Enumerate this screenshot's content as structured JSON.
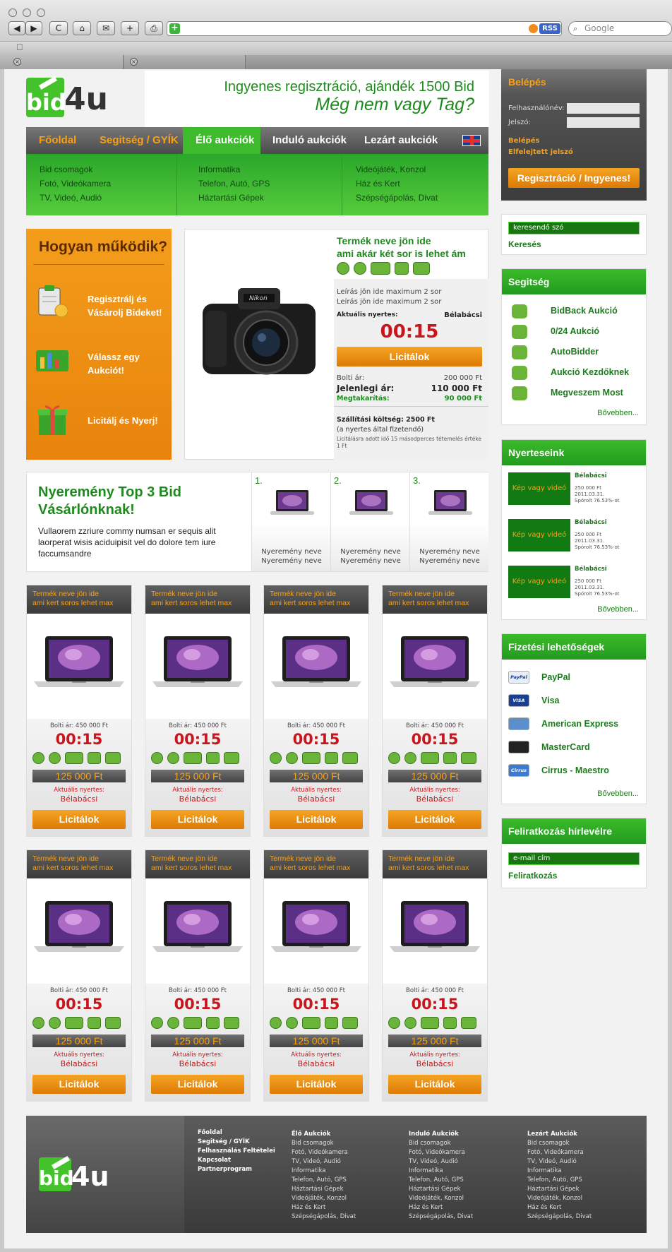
{
  "browser": {
    "nav_buttons": [
      "◀",
      "▶",
      "C",
      "⌂",
      "✉",
      "+",
      "⎙"
    ],
    "rss_label": "RSS",
    "search_placeholder": "Google",
    "bookmarks_icon": "book-icon"
  },
  "header": {
    "logo_bid": "bid",
    "logo_4u": "4u",
    "line1": "Ingyenes regisztráció, ajándék 1500 Bid",
    "line2": "Még nem vagy Tag?"
  },
  "nav": {
    "items": [
      "Főoldal",
      "Segitség / GYÍK",
      "Élő aukciók",
      "Induló aukciók",
      "Lezárt aukciók"
    ],
    "active_index": 2
  },
  "subnav": {
    "col1": [
      "Bid csomagok",
      "Fotó, Videókamera",
      "TV, Videó, Audió"
    ],
    "col2": [
      "Informatika",
      "Telefon, Autó, GPS",
      "Háztartási Gépek"
    ],
    "col3": [
      "Videójáték, Konzol",
      "Ház és Kert",
      "Szépségápolás, Divat"
    ]
  },
  "how": {
    "title": "Hogyan működik?",
    "steps": [
      "Regisztrálj és\nVásárolj Bideket!",
      "Válassz egy\nAukciót!",
      "Licitálj és Nyerj!"
    ]
  },
  "featured": {
    "name": "Termék neve jön ide\nami akár két sor is lehet ám",
    "desc1": "Leírás jön ide maximum 2 sor",
    "desc2": "Leírás jön ide maximum 2 sor",
    "winner_label": "Aktuális nyertes:",
    "winner": "Bélabácsi",
    "timer": "00:15",
    "button": "Licitálok",
    "store_label": "Bolti ár:",
    "store_price": "200 000 Ft",
    "current_label": "Jelenlegi ár:",
    "current_price": "110 000 Ft",
    "saving_label": "Megtakarítás:",
    "saving": "90 000 Ft",
    "shipping": "Szállítási költség: 2500 Ft",
    "shipping_note": "(a nyertes által fizetendő)",
    "bid_note": "Licitálásra adott idő 15 másodperces tétemelés értéke 1 Ft"
  },
  "top3": {
    "title": "Nyeremény Top 3 Bid\nVásárlónknak!",
    "desc": "Vullaorem zzriure commy numsan er sequis alit laorperat wisis aciduipisit vel do dolore tem iure faccumsandre",
    "items": [
      {
        "num": "1.",
        "cap1": "Nyeremény neve",
        "cap2": "Nyeremény neve"
      },
      {
        "num": "2.",
        "cap1": "Nyeremény neve",
        "cap2": "Nyeremény neve"
      },
      {
        "num": "3.",
        "cap1": "Nyeremény neve",
        "cap2": "Nyeremény neve"
      }
    ]
  },
  "product_card": {
    "name": "Termék neve jön ide\nami kert soros lehet max",
    "store_price": "Bolti ár: 450 000 Ft",
    "timer": "00:15",
    "bid": "125 000 Ft",
    "winner_label": "Aktuális nyertes:",
    "winner": "Bélabácsi",
    "button": "Licitálok"
  },
  "product_cards_count": 8,
  "icon_row": [
    "moneybag-icon",
    "clock-icon",
    "truck-icon",
    "wrench-icon",
    "cart-icon"
  ],
  "login": {
    "title": "Belépés",
    "user_label": "Felhasználónév:",
    "pass_label": "Jelszó:",
    "login_link": "Belépés",
    "forgot_link": "Elfelejtett jelszó",
    "register_btn": "Regisztráció / Ingyenes!"
  },
  "search": {
    "placeholder": "keresendő szó",
    "button": "Keresés"
  },
  "help": {
    "title": "Segitség",
    "items": [
      "BidBack Aukció",
      "0/24 Aukció",
      "AutoBidder",
      "Aukció Kezdőknek",
      "Megveszem Most"
    ],
    "more": "Bővebben..."
  },
  "winners": {
    "title": "Nyerteseink",
    "items": [
      {
        "box": "Kép vagy videó",
        "name": "Bélabácsi",
        "d1": "250 000 Ft",
        "d2": "2011.03.31.",
        "d3": "Spórolt 76.53%-ot"
      },
      {
        "box": "Kép vagy videó",
        "name": "Bélabácsi",
        "d1": "250 000 Ft",
        "d2": "2011.03.31.",
        "d3": "Spórolt 76.53%-ot"
      },
      {
        "box": "Kép vagy videó",
        "name": "Bélabácsi",
        "d1": "250 000 Ft",
        "d2": "2011.03.31.",
        "d3": "Spórolt 76.53%-ot"
      }
    ],
    "more": "Bővebben..."
  },
  "payment": {
    "title": "Fizetési lehetőségek",
    "items": [
      "PayPal",
      "Visa",
      "American Express",
      "MasterCard",
      "Cirrus - Maestro"
    ],
    "icon_texts": [
      "PayPal",
      "VISA",
      "",
      "",
      "Cirrus"
    ],
    "more": "Bővebben..."
  },
  "newsletter": {
    "title": "Feliratkozás hírlevélre",
    "placeholder": "e-mail cím",
    "button": "Feliratkozás"
  },
  "footer": {
    "col1": [
      "Főoldal",
      "Segitség / GYÍK",
      "Felhasználás Feltételei",
      "Kapcsolat",
      "Partnerprogram"
    ],
    "col2_title": "Élő Aukciók",
    "col3_title": "Induló Aukciók",
    "col4_title": "Lezárt Aukciók",
    "links": [
      "Bid csomagok",
      "Fotó, Videókamera",
      "TV, Videó, Audió",
      "Informatika",
      "Telefon, Autó, GPS",
      "Háztartási Gépek",
      "Videójáték, Konzol",
      "Ház és Kert",
      "Szépségápolás, Divat"
    ]
  },
  "colors": {
    "brand_green": "#3ebb2d",
    "brand_orange": "#f39d1b",
    "timer_red": "#c8161d",
    "dark_gray": "#444444"
  }
}
